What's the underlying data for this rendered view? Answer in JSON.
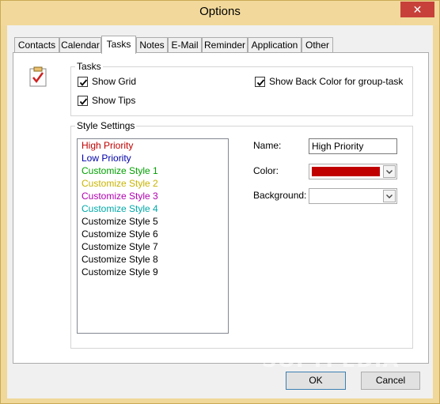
{
  "window": {
    "title": "Options",
    "close_glyph": "✕",
    "watermark": "SOFTPEDIA"
  },
  "tabs": [
    {
      "label": "Contacts",
      "active": false
    },
    {
      "label": "Calendar",
      "active": false
    },
    {
      "label": "Tasks",
      "active": true
    },
    {
      "label": "Notes",
      "active": false
    },
    {
      "label": "E-Mail",
      "active": false
    },
    {
      "label": "Reminder",
      "active": false
    },
    {
      "label": "Application",
      "active": false
    },
    {
      "label": "Other",
      "active": false
    }
  ],
  "tasks_group": {
    "legend": "Tasks",
    "show_grid": {
      "label": "Show Grid",
      "checked": true
    },
    "show_tips": {
      "label": "Show Tips",
      "checked": true
    },
    "show_back_color": {
      "label": "Show Back Color for group-task",
      "checked": true
    }
  },
  "style_group": {
    "legend": "Style Settings",
    "styles": [
      {
        "label": "High Priority",
        "color": "#c00000"
      },
      {
        "label": "Low Priority",
        "color": "#0000a8"
      },
      {
        "label": "Customize Style 1",
        "color": "#00a000"
      },
      {
        "label": "Customize Style 2",
        "color": "#c8b400"
      },
      {
        "label": "Customize Style 3",
        "color": "#b000b0"
      },
      {
        "label": "Customize Style 4",
        "color": "#00a8a8"
      },
      {
        "label": "Customize Style 5",
        "color": "#000000"
      },
      {
        "label": "Customize Style 6",
        "color": "#000000"
      },
      {
        "label": "Customize Style 7",
        "color": "#000000"
      },
      {
        "label": "Customize Style 8",
        "color": "#000000"
      },
      {
        "label": "Customize Style 9",
        "color": "#000000"
      }
    ],
    "name_label": "Name:",
    "name_value": "High Priority",
    "color_label": "Color:",
    "color_value": "#c00000",
    "background_label": "Background:",
    "background_value": ""
  },
  "buttons": {
    "ok": "OK",
    "cancel": "Cancel"
  },
  "colors": {
    "titlebar": "#f2d99b",
    "close_button": "#c7413a",
    "dialog_bg": "#f0f0f0"
  },
  "icons": {
    "close": "close-icon",
    "tasks": "clipboard-check-icon",
    "checkbox_check": "checkmark-icon",
    "combo_arrow": "chevron-down-icon"
  }
}
